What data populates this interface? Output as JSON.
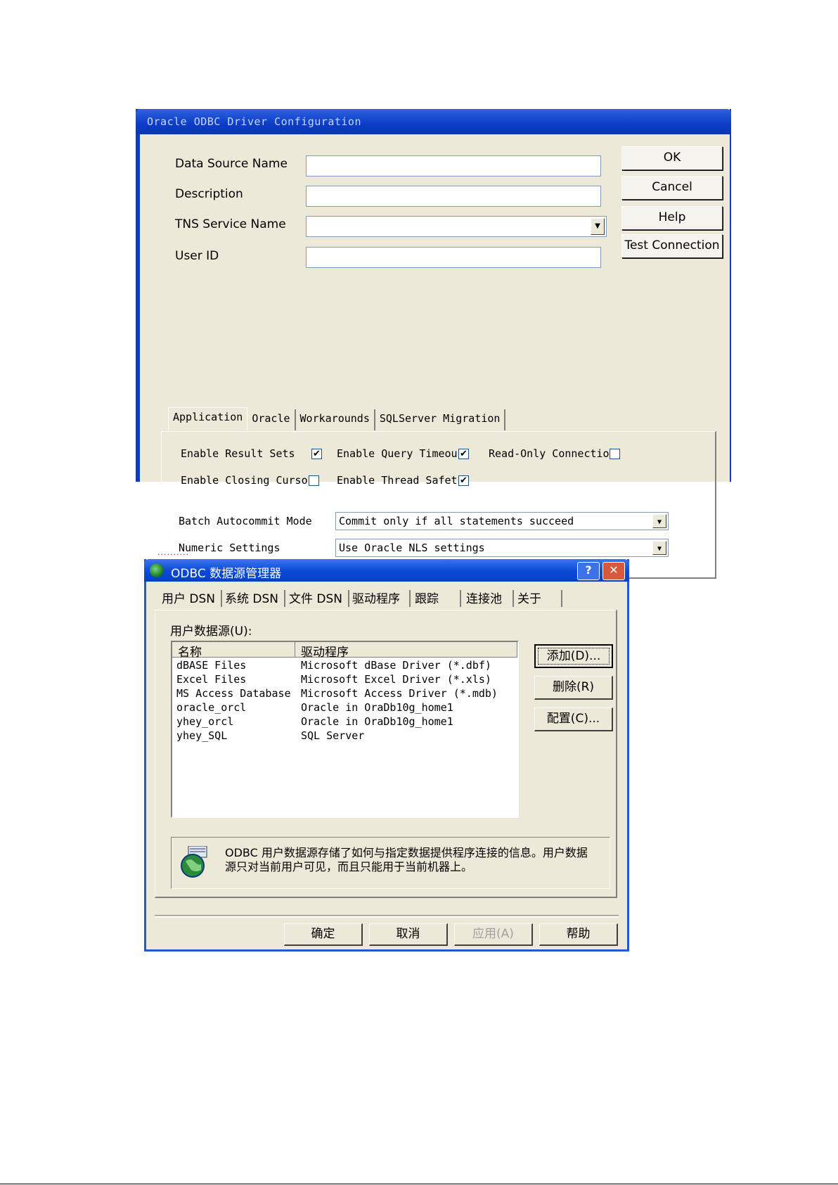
{
  "oracle_dialog": {
    "title": "Oracle ODBC Driver Configuration",
    "fields": {
      "data_source_name_label": "Data Source Name",
      "description_label": "Description",
      "tns_service_name_label": "TNS Service Name",
      "user_id_label": "User ID"
    },
    "buttons": {
      "ok": "OK",
      "cancel": "Cancel",
      "help": "Help",
      "test_connection": "Test Connection"
    },
    "tabs": [
      "Application",
      "Oracle",
      "Workarounds",
      "SQLServer Migration"
    ],
    "options": {
      "enable_result_sets": "Enable Result Sets",
      "enable_query_timeout": "Enable Query Timeou",
      "read_only_connection": "Read-Only Connectio",
      "enable_closing_cursor": "Enable Closing Curso",
      "enable_thread_safety": "Enable Thread Safet",
      "check_mark": "✔"
    },
    "batch_autocommit_label": "Batch Autocommit Mode",
    "batch_autocommit_value": "Commit only if all statements succeed",
    "numeric_settings_label": "Numeric Settings",
    "numeric_settings_value": "Use Oracle NLS settings",
    "dropdown_arrow": "▼"
  },
  "odbc_dialog": {
    "title": "ODBC 数据源管理器",
    "titlebar_buttons": {
      "help": "?",
      "close": "✕"
    },
    "tabs": [
      "用户 DSN",
      "系统 DSN",
      "文件 DSN",
      "驱动程序",
      "跟踪",
      "连接池",
      "关于"
    ],
    "user_ds_label": "用户数据源(U):",
    "columns": [
      "名称",
      "驱动程序"
    ],
    "rows": [
      {
        "name": "dBASE Files",
        "driver": "Microsoft dBase Driver (*.dbf)"
      },
      {
        "name": "Excel Files",
        "driver": "Microsoft Excel Driver (*.xls)"
      },
      {
        "name": "MS Access Database",
        "driver": "Microsoft Access Driver (*.mdb)"
      },
      {
        "name": "oracle_orcl",
        "driver": "Oracle in OraDb10g_home1"
      },
      {
        "name": "yhey_orcl",
        "driver": "Oracle in OraDb10g_home1"
      },
      {
        "name": "yhey_SQL",
        "driver": "SQL Server"
      }
    ],
    "side_buttons": {
      "add": "添加(D)...",
      "remove": "删除(R)",
      "configure": "配置(C)..."
    },
    "info_text": "ODBC 用户数据源存储了如何与指定数据提供程序连接的信息。用户数据源只对当前用户可见，而且只能用于当前机器上。",
    "bottom_buttons": {
      "ok": "确定",
      "cancel": "取消",
      "apply": "应用(A)",
      "help": "帮助"
    }
  },
  "separator_dots": ".........."
}
